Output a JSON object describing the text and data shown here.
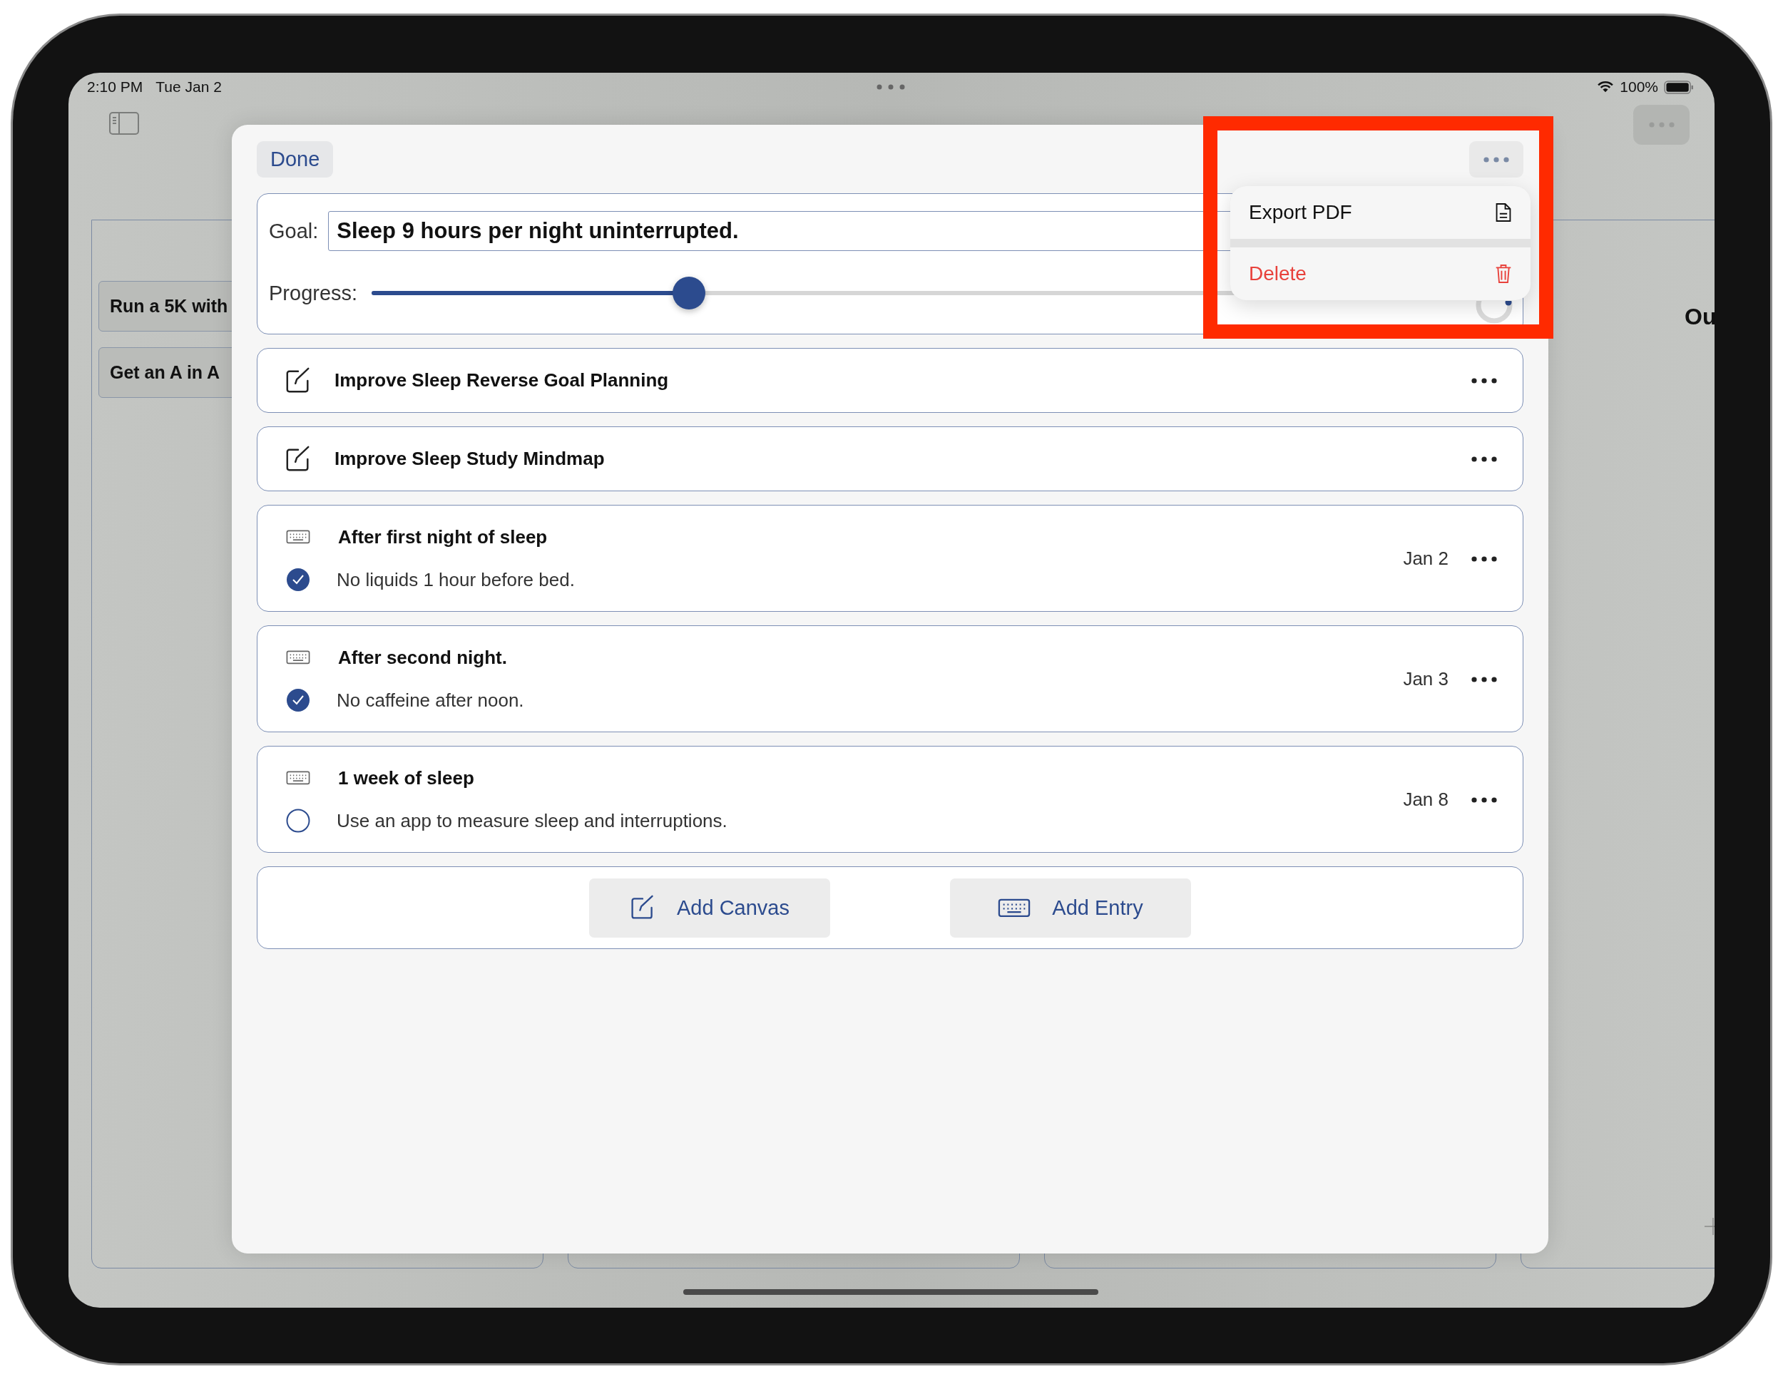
{
  "status_bar": {
    "time": "2:10 PM",
    "date": "Tue Jan 2",
    "battery": "100%"
  },
  "background": {
    "cards": [
      {
        "title": "Run a 5K with"
      },
      {
        "title": "Get an A in A"
      }
    ],
    "heading": "Ou"
  },
  "sheet": {
    "done": "Done",
    "goal_label": "Goal:",
    "goal_value": "Sleep 9 hours per night uninterrupted.",
    "progress_label": "Progress:",
    "progress": {
      "level": 0.3
    },
    "items": [
      {
        "kind": "canvas",
        "title": "Improve Sleep Reverse Goal Planning"
      },
      {
        "kind": "canvas",
        "title": "Improve Sleep Study Mindmap"
      },
      {
        "kind": "entry",
        "title": "After first night of sleep",
        "note": "No liquids 1 hour before bed.",
        "checked": true,
        "date": "Jan 2"
      },
      {
        "kind": "entry",
        "title": "After second night.",
        "note": "No caffeine after noon.",
        "checked": true,
        "date": "Jan 3"
      },
      {
        "kind": "entry",
        "title": "1 week of sleep",
        "note": "Use an app to measure sleep and interruptions.",
        "checked": false,
        "date": "Jan 8"
      }
    ],
    "actions": [
      {
        "kind": "canvas",
        "label": "Add Canvas"
      },
      {
        "kind": "entry",
        "label": "Add Entry"
      }
    ]
  },
  "menu": {
    "items": [
      {
        "kind": "export",
        "label": "Export PDF"
      },
      {
        "kind": "delete",
        "label": "Delete"
      }
    ]
  }
}
